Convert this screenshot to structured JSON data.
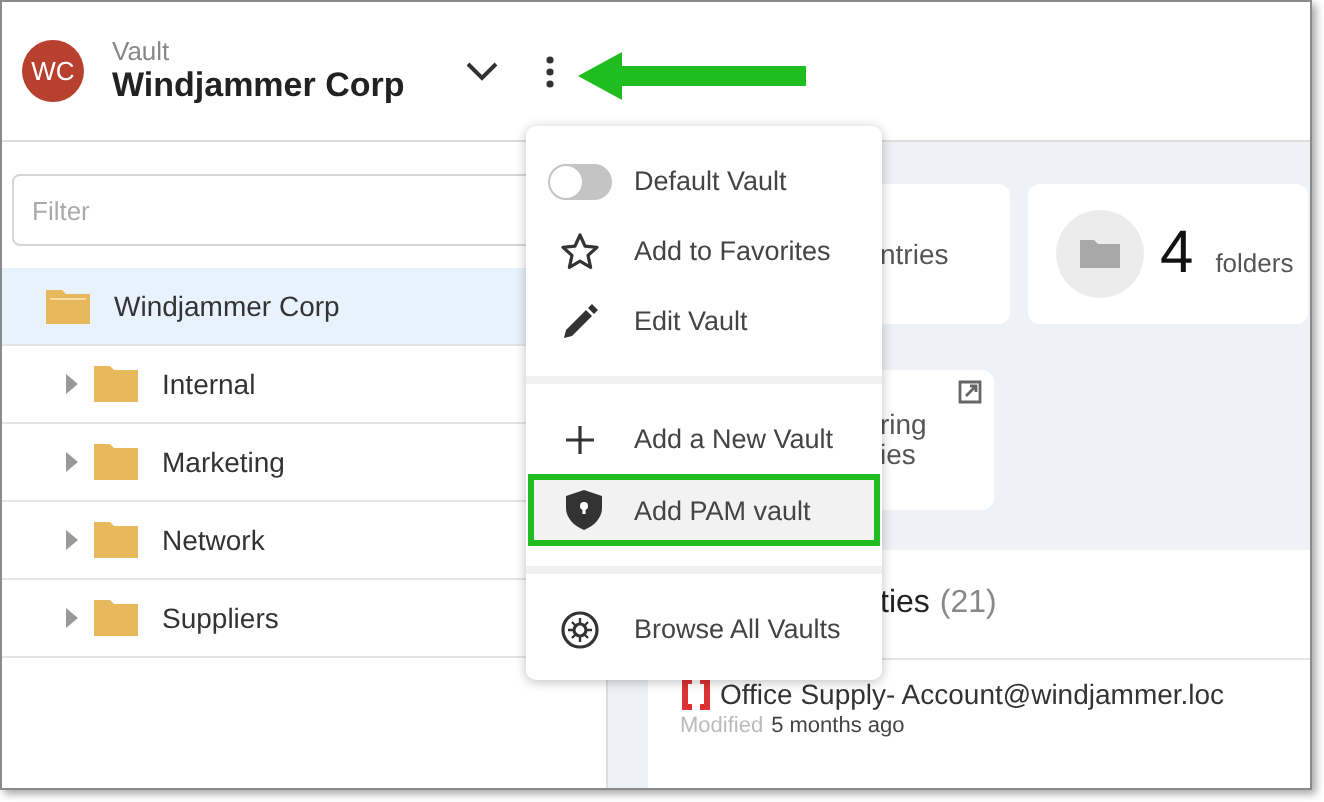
{
  "header": {
    "avatar": "WC",
    "label": "Vault",
    "title": "Windjammer Corp"
  },
  "filter": {
    "placeholder": "Filter"
  },
  "tree": [
    {
      "label": "Windjammer Corp",
      "selected": true,
      "children": [
        {
          "label": "Internal",
          "selected": false
        },
        {
          "label": "Marketing",
          "selected": false
        },
        {
          "label": "Network",
          "selected": false
        },
        {
          "label": "Suppliers",
          "selected": false
        }
      ]
    }
  ],
  "cards": [
    {
      "kind": "entries",
      "text": "ntries"
    },
    {
      "kind": "folders",
      "count": "4",
      "label": "folders"
    },
    {
      "kind": "link",
      "lines": [
        "ring",
        "ies"
      ]
    }
  ],
  "list": {
    "title": "ties",
    "count": "(21)",
    "entries": [
      {
        "title": "Office Supply- Account@windjammer.loc",
        "modified_label": "Modified",
        "modified": "5 months ago"
      }
    ]
  },
  "menu": {
    "groups": [
      [
        {
          "kind": "toggle",
          "label": "Default Vault",
          "on": false,
          "highlighted": false
        },
        {
          "kind": "star",
          "label": "Add to Favorites",
          "highlighted": false
        },
        {
          "kind": "pencil",
          "label": "Edit Vault",
          "highlighted": false
        }
      ],
      [
        {
          "kind": "plus",
          "label": "Add a New Vault",
          "highlighted": false
        },
        {
          "kind": "shield",
          "label": "Add PAM vault",
          "highlighted": true
        }
      ],
      [
        {
          "kind": "browse",
          "label": "Browse All Vaults",
          "highlighted": false
        }
      ]
    ]
  }
}
